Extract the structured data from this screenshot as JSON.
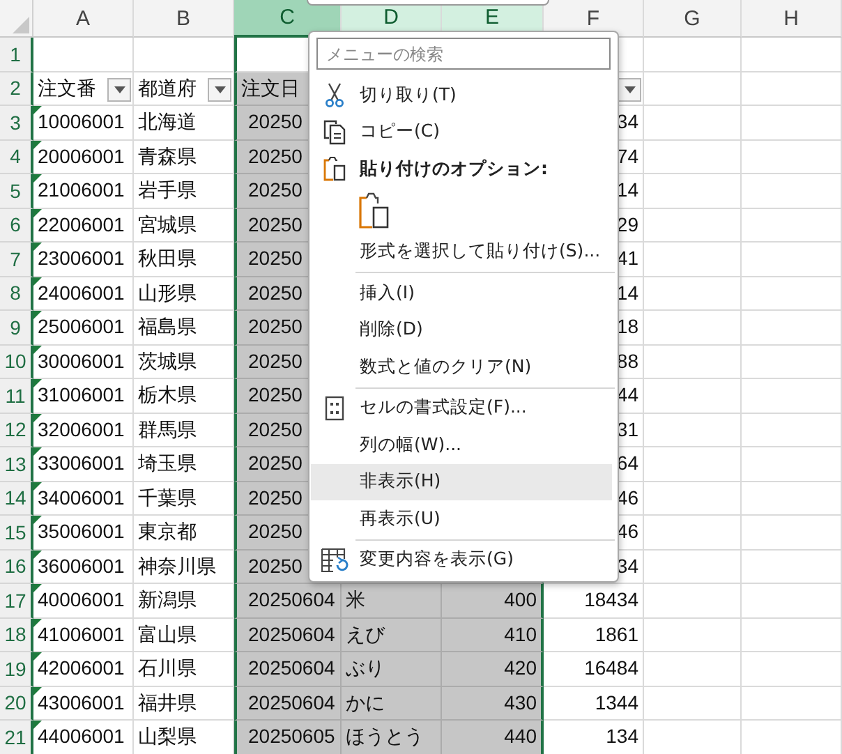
{
  "columns": [
    {
      "letter": "A",
      "selected": false,
      "active": false
    },
    {
      "letter": "B",
      "selected": false,
      "active": false
    },
    {
      "letter": "C",
      "selected": true,
      "active": true
    },
    {
      "letter": "D",
      "selected": true,
      "active": false
    },
    {
      "letter": "E",
      "selected": true,
      "active": false
    },
    {
      "letter": "F",
      "selected": false,
      "active": false
    },
    {
      "letter": "G",
      "selected": false,
      "active": false
    },
    {
      "letter": "H",
      "selected": false,
      "active": false
    }
  ],
  "rows": [
    {
      "number": "1",
      "flagged": false,
      "active": true,
      "cells": [
        null,
        null,
        null,
        null,
        null,
        null,
        null,
        null
      ]
    },
    {
      "number": "2",
      "flagged": false,
      "active": false,
      "cells": [
        {
          "text": "注文番",
          "filter": true
        },
        {
          "text": "都道府",
          "filter": true
        },
        {
          "text": "注文日"
        },
        null,
        null,
        {
          "text": null,
          "filter": true
        },
        null,
        null
      ]
    },
    {
      "number": "3",
      "flagged": true,
      "active": false,
      "cells": [
        "10006001",
        "北海道",
        "20250",
        null,
        null,
        "34",
        null,
        null
      ]
    },
    {
      "number": "4",
      "flagged": true,
      "active": false,
      "cells": [
        "20006001",
        "青森県",
        "20250",
        null,
        null,
        "74",
        null,
        null
      ]
    },
    {
      "number": "5",
      "flagged": true,
      "active": false,
      "cells": [
        "21006001",
        "岩手県",
        "20250",
        null,
        null,
        "14",
        null,
        null
      ]
    },
    {
      "number": "6",
      "flagged": true,
      "active": false,
      "cells": [
        "22006001",
        "宮城県",
        "20250",
        null,
        null,
        "29",
        null,
        null
      ]
    },
    {
      "number": "7",
      "flagged": true,
      "active": false,
      "cells": [
        "23006001",
        "秋田県",
        "20250",
        null,
        null,
        "41",
        null,
        null
      ]
    },
    {
      "number": "8",
      "flagged": true,
      "active": false,
      "cells": [
        "24006001",
        "山形県",
        "20250",
        null,
        null,
        "14",
        null,
        null
      ]
    },
    {
      "number": "9",
      "flagged": true,
      "active": false,
      "cells": [
        "25006001",
        "福島県",
        "20250",
        null,
        null,
        "18",
        null,
        null
      ]
    },
    {
      "number": "10",
      "flagged": true,
      "active": false,
      "cells": [
        "30006001",
        "茨城県",
        "20250",
        null,
        null,
        "88",
        null,
        null
      ]
    },
    {
      "number": "11",
      "flagged": true,
      "active": false,
      "cells": [
        "31006001",
        "栃木県",
        "20250",
        null,
        null,
        "44",
        null,
        null
      ]
    },
    {
      "number": "12",
      "flagged": true,
      "active": false,
      "cells": [
        "32006001",
        "群馬県",
        "20250",
        null,
        null,
        "31",
        null,
        null
      ]
    },
    {
      "number": "13",
      "flagged": true,
      "active": false,
      "cells": [
        "33006001",
        "埼玉県",
        "20250",
        null,
        null,
        "64",
        null,
        null
      ]
    },
    {
      "number": "14",
      "flagged": true,
      "active": false,
      "cells": [
        "34006001",
        "千葉県",
        "20250",
        null,
        null,
        "46",
        null,
        null
      ]
    },
    {
      "number": "15",
      "flagged": true,
      "active": false,
      "cells": [
        "35006001",
        "東京都",
        "20250",
        null,
        null,
        "46",
        null,
        null
      ]
    },
    {
      "number": "16",
      "flagged": true,
      "active": false,
      "cells": [
        "36006001",
        "神奈川県",
        "20250",
        null,
        null,
        "34",
        null,
        null
      ]
    },
    {
      "number": "17",
      "flagged": true,
      "active": false,
      "cells": [
        "40006001",
        "新潟県",
        "20250604",
        "米",
        "400",
        "18434",
        null,
        null
      ]
    },
    {
      "number": "18",
      "flagged": true,
      "active": false,
      "cells": [
        "41006001",
        "富山県",
        "20250604",
        "えび",
        "410",
        "1861",
        null,
        null
      ]
    },
    {
      "number": "19",
      "flagged": true,
      "active": false,
      "cells": [
        "42006001",
        "石川県",
        "20250604",
        "ぶり",
        "420",
        "16484",
        null,
        null
      ]
    },
    {
      "number": "20",
      "flagged": true,
      "active": false,
      "cells": [
        "43006001",
        "福井県",
        "20250604",
        "かに",
        "430",
        "1344",
        null,
        null
      ]
    },
    {
      "number": "21",
      "flagged": true,
      "active": false,
      "cells": [
        "44006001",
        "山梨県",
        "20250605",
        "ほうとう",
        "440",
        "134",
        null,
        null
      ]
    }
  ],
  "context_menu": {
    "search": {
      "placeholder": "メニューの検索"
    },
    "items": [
      {
        "kind": "cut",
        "label": "切り取り(T)",
        "highlighted": false
      },
      {
        "kind": "copy",
        "label": "コピー(C)",
        "highlighted": false
      },
      {
        "kind": "paste-header",
        "label": "貼り付けのオプション:",
        "highlighted": false
      },
      {
        "kind": "paste-icons",
        "highlighted": false
      },
      {
        "kind": "plain",
        "label": "形式を選択して貼り付け(S)...",
        "highlighted": false
      },
      {
        "kind": "separator"
      },
      {
        "kind": "plain",
        "label": "挿入(I)",
        "highlighted": false
      },
      {
        "kind": "plain",
        "label": "削除(D)",
        "highlighted": false
      },
      {
        "kind": "plain",
        "label": "数式と値のクリア(N)",
        "highlighted": false
      },
      {
        "kind": "separator"
      },
      {
        "kind": "format",
        "label": "セルの書式設定(F)...",
        "highlighted": false
      },
      {
        "kind": "plain",
        "label": "列の幅(W)...",
        "highlighted": false
      },
      {
        "kind": "plain",
        "label": "非表示(H)",
        "highlighted": true
      },
      {
        "kind": "plain",
        "label": "再表示(U)",
        "highlighted": false
      },
      {
        "kind": "separator"
      },
      {
        "kind": "changes",
        "label": "変更内容を表示(G)",
        "highlighted": false
      }
    ]
  }
}
